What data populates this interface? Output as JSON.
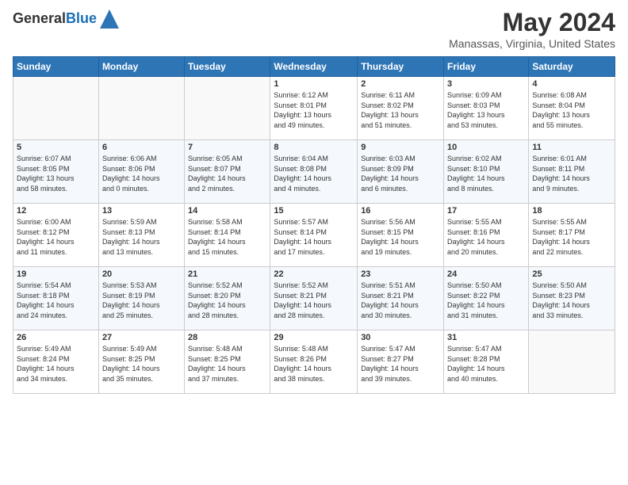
{
  "header": {
    "logo_general": "General",
    "logo_blue": "Blue",
    "main_title": "May 2024",
    "subtitle": "Manassas, Virginia, United States"
  },
  "weekdays": [
    "Sunday",
    "Monday",
    "Tuesday",
    "Wednesday",
    "Thursday",
    "Friday",
    "Saturday"
  ],
  "weeks": [
    [
      {
        "day": "",
        "info": ""
      },
      {
        "day": "",
        "info": ""
      },
      {
        "day": "",
        "info": ""
      },
      {
        "day": "1",
        "info": "Sunrise: 6:12 AM\nSunset: 8:01 PM\nDaylight: 13 hours\nand 49 minutes."
      },
      {
        "day": "2",
        "info": "Sunrise: 6:11 AM\nSunset: 8:02 PM\nDaylight: 13 hours\nand 51 minutes."
      },
      {
        "day": "3",
        "info": "Sunrise: 6:09 AM\nSunset: 8:03 PM\nDaylight: 13 hours\nand 53 minutes."
      },
      {
        "day": "4",
        "info": "Sunrise: 6:08 AM\nSunset: 8:04 PM\nDaylight: 13 hours\nand 55 minutes."
      }
    ],
    [
      {
        "day": "5",
        "info": "Sunrise: 6:07 AM\nSunset: 8:05 PM\nDaylight: 13 hours\nand 58 minutes."
      },
      {
        "day": "6",
        "info": "Sunrise: 6:06 AM\nSunset: 8:06 PM\nDaylight: 14 hours\nand 0 minutes."
      },
      {
        "day": "7",
        "info": "Sunrise: 6:05 AM\nSunset: 8:07 PM\nDaylight: 14 hours\nand 2 minutes."
      },
      {
        "day": "8",
        "info": "Sunrise: 6:04 AM\nSunset: 8:08 PM\nDaylight: 14 hours\nand 4 minutes."
      },
      {
        "day": "9",
        "info": "Sunrise: 6:03 AM\nSunset: 8:09 PM\nDaylight: 14 hours\nand 6 minutes."
      },
      {
        "day": "10",
        "info": "Sunrise: 6:02 AM\nSunset: 8:10 PM\nDaylight: 14 hours\nand 8 minutes."
      },
      {
        "day": "11",
        "info": "Sunrise: 6:01 AM\nSunset: 8:11 PM\nDaylight: 14 hours\nand 9 minutes."
      }
    ],
    [
      {
        "day": "12",
        "info": "Sunrise: 6:00 AM\nSunset: 8:12 PM\nDaylight: 14 hours\nand 11 minutes."
      },
      {
        "day": "13",
        "info": "Sunrise: 5:59 AM\nSunset: 8:13 PM\nDaylight: 14 hours\nand 13 minutes."
      },
      {
        "day": "14",
        "info": "Sunrise: 5:58 AM\nSunset: 8:14 PM\nDaylight: 14 hours\nand 15 minutes."
      },
      {
        "day": "15",
        "info": "Sunrise: 5:57 AM\nSunset: 8:14 PM\nDaylight: 14 hours\nand 17 minutes."
      },
      {
        "day": "16",
        "info": "Sunrise: 5:56 AM\nSunset: 8:15 PM\nDaylight: 14 hours\nand 19 minutes."
      },
      {
        "day": "17",
        "info": "Sunrise: 5:55 AM\nSunset: 8:16 PM\nDaylight: 14 hours\nand 20 minutes."
      },
      {
        "day": "18",
        "info": "Sunrise: 5:55 AM\nSunset: 8:17 PM\nDaylight: 14 hours\nand 22 minutes."
      }
    ],
    [
      {
        "day": "19",
        "info": "Sunrise: 5:54 AM\nSunset: 8:18 PM\nDaylight: 14 hours\nand 24 minutes."
      },
      {
        "day": "20",
        "info": "Sunrise: 5:53 AM\nSunset: 8:19 PM\nDaylight: 14 hours\nand 25 minutes."
      },
      {
        "day": "21",
        "info": "Sunrise: 5:52 AM\nSunset: 8:20 PM\nDaylight: 14 hours\nand 28 minutes."
      },
      {
        "day": "22",
        "info": "Sunrise: 5:52 AM\nSunset: 8:21 PM\nDaylight: 14 hours\nand 28 minutes."
      },
      {
        "day": "23",
        "info": "Sunrise: 5:51 AM\nSunset: 8:21 PM\nDaylight: 14 hours\nand 30 minutes."
      },
      {
        "day": "24",
        "info": "Sunrise: 5:50 AM\nSunset: 8:22 PM\nDaylight: 14 hours\nand 31 minutes."
      },
      {
        "day": "25",
        "info": "Sunrise: 5:50 AM\nSunset: 8:23 PM\nDaylight: 14 hours\nand 33 minutes."
      }
    ],
    [
      {
        "day": "26",
        "info": "Sunrise: 5:49 AM\nSunset: 8:24 PM\nDaylight: 14 hours\nand 34 minutes."
      },
      {
        "day": "27",
        "info": "Sunrise: 5:49 AM\nSunset: 8:25 PM\nDaylight: 14 hours\nand 35 minutes."
      },
      {
        "day": "28",
        "info": "Sunrise: 5:48 AM\nSunset: 8:25 PM\nDaylight: 14 hours\nand 37 minutes."
      },
      {
        "day": "29",
        "info": "Sunrise: 5:48 AM\nSunset: 8:26 PM\nDaylight: 14 hours\nand 38 minutes."
      },
      {
        "day": "30",
        "info": "Sunrise: 5:47 AM\nSunset: 8:27 PM\nDaylight: 14 hours\nand 39 minutes."
      },
      {
        "day": "31",
        "info": "Sunrise: 5:47 AM\nSunset: 8:28 PM\nDaylight: 14 hours\nand 40 minutes."
      },
      {
        "day": "",
        "info": ""
      }
    ]
  ]
}
